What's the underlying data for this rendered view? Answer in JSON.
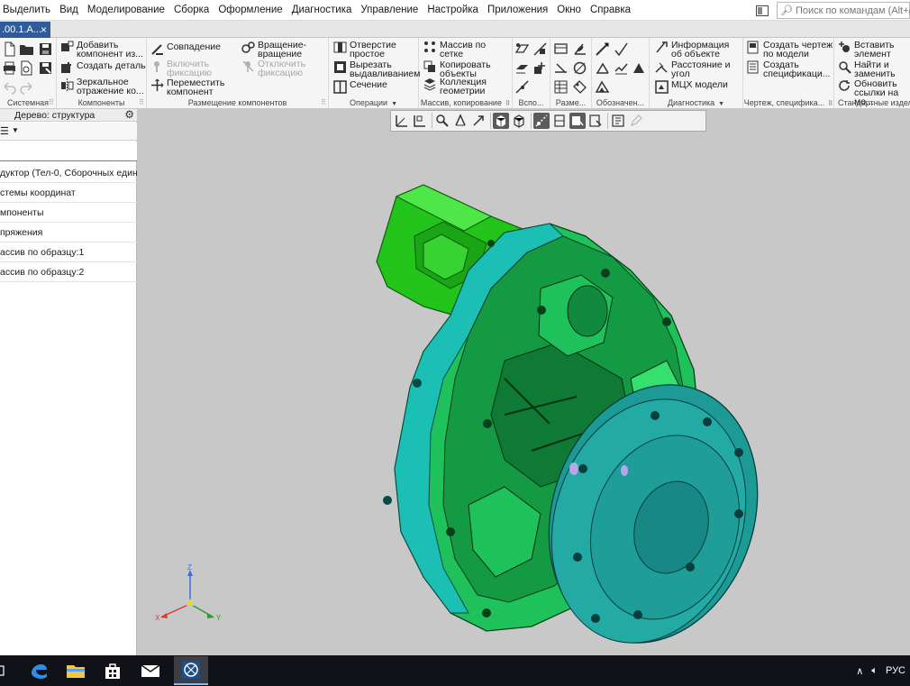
{
  "menu": [
    "Выделить",
    "Вид",
    "Моделирование",
    "Сборка",
    "Оформление",
    "Диагностика",
    "Управление",
    "Настройка",
    "Приложения",
    "Окно",
    "Справка"
  ],
  "search": {
    "placeholder": "Поиск по командам (Alt+/)"
  },
  "doc_tab": {
    "title": ".00.1.А..."
  },
  "ribbon": {
    "groups": [
      {
        "caption": "Системная"
      },
      {
        "caption": "Компоненты"
      },
      {
        "caption": "Размещение компонентов"
      },
      {
        "caption": "Операции"
      },
      {
        "caption": "Массив, копирование"
      },
      {
        "caption": "Вспо..."
      },
      {
        "caption": "Разме..."
      },
      {
        "caption": "Обозначен..."
      },
      {
        "caption": "Диагностика"
      },
      {
        "caption": "Чертеж, специфика..."
      },
      {
        "caption": "Стандартные издели"
      }
    ],
    "commands": {
      "add_component": "Добавить компонент из...",
      "create_part": "Создать деталь",
      "mirror": "Зеркальное отражение ко...",
      "coincidence": "Совпадение",
      "enable_fix": "Включить фиксацию",
      "move_component": "Переместить компонент",
      "rotation": "Вращение-вращение",
      "disable_fix": "Отключить фиксацию",
      "simple_hole": "Отверстие простое",
      "extrude_cut": "Вырезать выдавливанием",
      "section": "Сечение",
      "grid_array": "Массив по сетке",
      "copy_objects": "Копировать объекты",
      "geom_collection": "Коллекция геометрии",
      "object_info": "Информация об объекте",
      "distance_angle": "Расстояние и угол",
      "mcx_models": "МЦХ модели",
      "create_drawing": "Создать чертеж по модели",
      "create_spec": "Создать спецификаци...",
      "insert_element": "Вставить элемент",
      "find_replace": "Найти и заменить",
      "update_links": "Обновить ссылки на мо..."
    }
  },
  "tree": {
    "title": "Дерево: структура",
    "rows": [
      "дуктор (Тел-0, Сборочных едини",
      "стемы координат",
      "мпоненты",
      "пряжения",
      "ассив по образцу:1",
      "ассив по образцу:2"
    ]
  },
  "triad": {
    "z": "Z",
    "x": "X",
    "y": "Y"
  },
  "tray": {
    "language": "РУС"
  },
  "colors": {
    "body_green": "#1fc25a",
    "cover_cyan": "#1bbfb4",
    "flange_teal": "#1d9a96",
    "motor_green": "#22c41c",
    "viewport_bg": "#c8c8c8"
  }
}
